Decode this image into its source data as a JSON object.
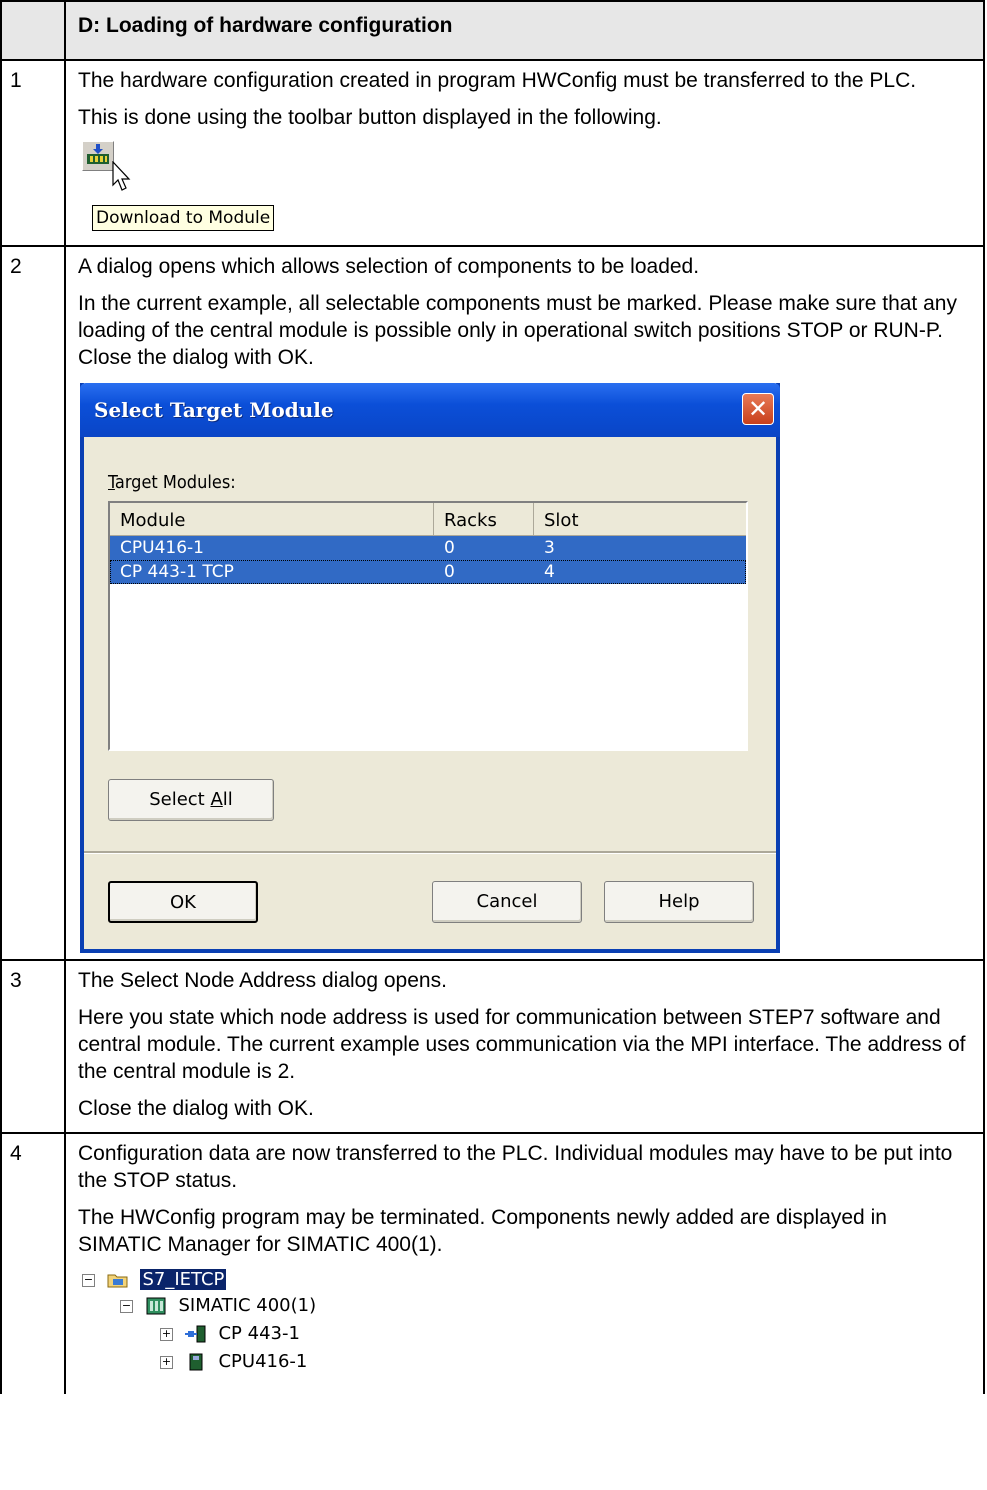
{
  "header": {
    "title": "D: Loading of hardware configuration"
  },
  "steps": [
    {
      "num": "1",
      "paragraphs": [
        "The hardware configuration created in program HWConfig must be transferred to the PLC.",
        "This is done using the toolbar button displayed in the following."
      ],
      "tooltip": "Download to Module"
    },
    {
      "num": "2",
      "paragraphs": [
        "A dialog opens which allows selection of components to be loaded.",
        "In the current example, all selectable components must be marked. Please make sure that any loading of the central module is possible only in operational switch positions STOP or RUN-P. Close the dialog with OK."
      ]
    },
    {
      "num": "3",
      "paragraphs": [
        "The Select Node Address dialog opens.",
        "Here you state which node address is used for communication between STEP7 software and central module. The current example uses communication via the MPI interface. The address of the central module is 2.",
        "Close the dialog with OK."
      ]
    },
    {
      "num": "4",
      "paragraphs": [
        "Configuration data are now transferred to the PLC. Individual modules may have to be put into the STOP status.",
        "The HWConfig program may be terminated. Components newly added are displayed in SIMATIC Manager for SIMATIC 400(1)."
      ]
    }
  ],
  "dialog": {
    "title": "Select Target Module",
    "close_glyph": "✕",
    "label_first": "T",
    "label_rest": "arget Modules:",
    "columns": [
      "Module",
      "Racks",
      "Slot"
    ],
    "rows": [
      {
        "module": "CPU416-1",
        "racks": "0",
        "slot": "3"
      },
      {
        "module": "CP 443-1 TCP",
        "racks": "0",
        "slot": "4"
      }
    ],
    "select_all_pre": "Select ",
    "select_all_key": "A",
    "select_all_post": "ll",
    "ok": "OK",
    "cancel": "Cancel",
    "help": "Help"
  },
  "tree": {
    "root": "S7_IETCP",
    "station": "SIMATIC 400(1)",
    "children": [
      "CP 443-1",
      "CPU416-1"
    ],
    "expand_minus": "−",
    "expand_plus": "+"
  },
  "colors": {
    "selection": "#316ac5",
    "titlebar": "#0b4fd8",
    "header_bg": "#e7e7e7"
  }
}
